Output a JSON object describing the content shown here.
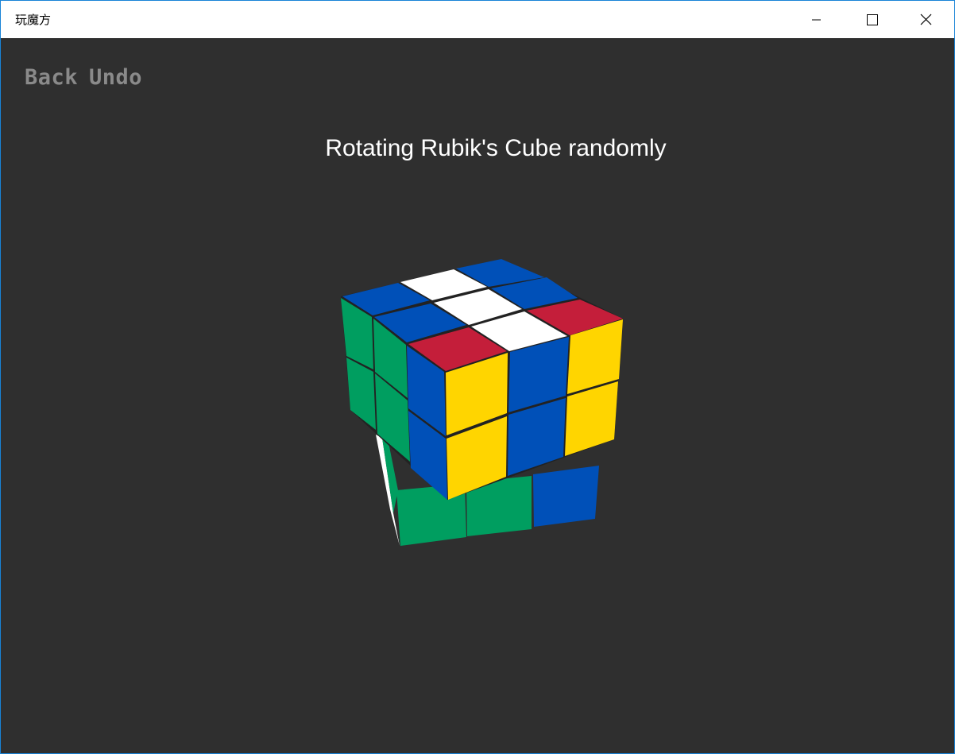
{
  "window": {
    "title": "玩魔方"
  },
  "nav": {
    "back_label": "Back",
    "undo_label": "Undo"
  },
  "status": {
    "message": "Rotating Rubik's Cube randomly"
  },
  "cube": {
    "sticker_colors": {
      "white": "#ffffff",
      "blue": "#0050b8",
      "red": "#c41e3a",
      "yellow": "#ffd500",
      "green": "#009e60"
    },
    "state": "mid-rotation"
  },
  "colors": {
    "background": "#2f2f2f",
    "nav_text": "#8a8a8a",
    "status_text": "#ffffff"
  }
}
